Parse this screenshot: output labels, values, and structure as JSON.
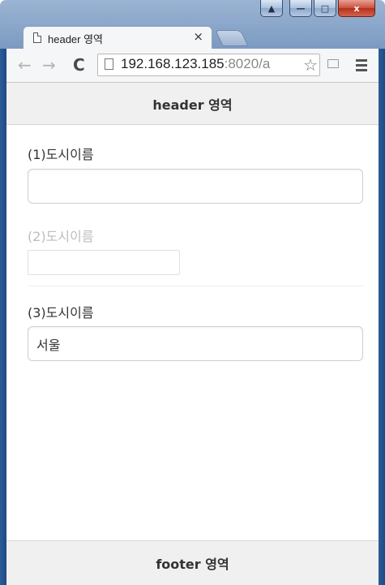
{
  "browser": {
    "tab": {
      "title": "header 영역",
      "close_glyph": "×"
    },
    "toolbar": {
      "back_glyph": "←",
      "forward_glyph": "→",
      "reload_glyph": "C",
      "url_host": "192.168.123.185",
      "url_rest": ":8020/a",
      "star_glyph": "☆"
    },
    "window_controls": {
      "minimize": "—",
      "maximize": "□",
      "close": "x",
      "user": "▲"
    }
  },
  "page": {
    "header_title": "header 영역",
    "footer_title": "footer 영역",
    "fields": [
      {
        "label": "(1)도시이름",
        "value": "",
        "placeholder": "",
        "disabled": false
      },
      {
        "label": "(2)도시이름",
        "value": "",
        "placeholder": "",
        "disabled": true
      },
      {
        "label": "(3)도시이름",
        "value": "서울",
        "placeholder": "",
        "disabled": false
      }
    ]
  },
  "icons": {
    "tab": "page-icon",
    "address": "page-icon",
    "bookmark": "star-icon",
    "extension": "cast-icon",
    "menu": "hamburger-menu-icon"
  },
  "colors": {
    "frame": "#1d4a86",
    "header_bg": "#f0f0f0",
    "close_button": "#c9503b",
    "disabled_label": "#bdbdbd"
  }
}
